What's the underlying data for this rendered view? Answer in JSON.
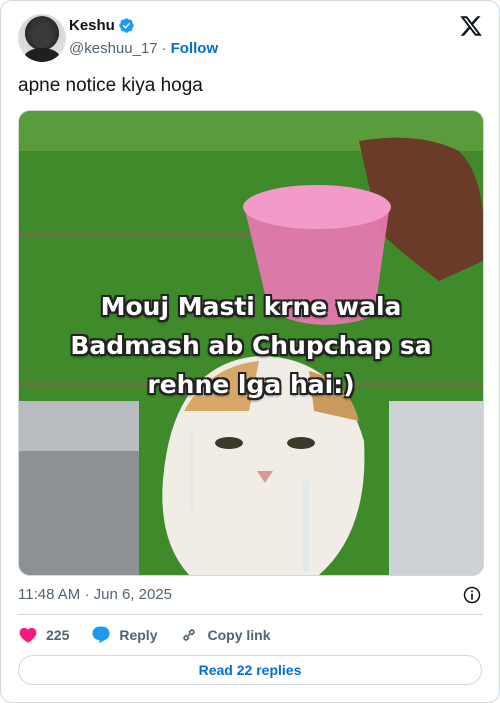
{
  "author": {
    "name": "Keshu",
    "handle": "@keshuu_17",
    "separator": "·",
    "follow_label": "Follow",
    "verified": true
  },
  "tweet": {
    "text": "apne notice kiya hoga",
    "meme_caption": [
      "Mouj Masti krne wala",
      "Badmash ab Chupchap sa",
      "rehne lga hai:)"
    ]
  },
  "meta": {
    "time": "11:48 AM",
    "separator": "·",
    "date": "Jun 6, 2025"
  },
  "actions": {
    "likes_count": "225",
    "reply_label": "Reply",
    "copy_link_label": "Copy link",
    "read_replies_label": "Read 22 replies"
  },
  "colors": {
    "accent": "#006fd6",
    "like": "#f91880",
    "reply_icon": "#1d9bf0",
    "muted": "#536471",
    "border": "#cfd9de"
  },
  "icons": [
    "verified-badge-icon",
    "x-logo-icon",
    "info-icon",
    "heart-icon",
    "reply-bubble-icon",
    "link-icon"
  ]
}
